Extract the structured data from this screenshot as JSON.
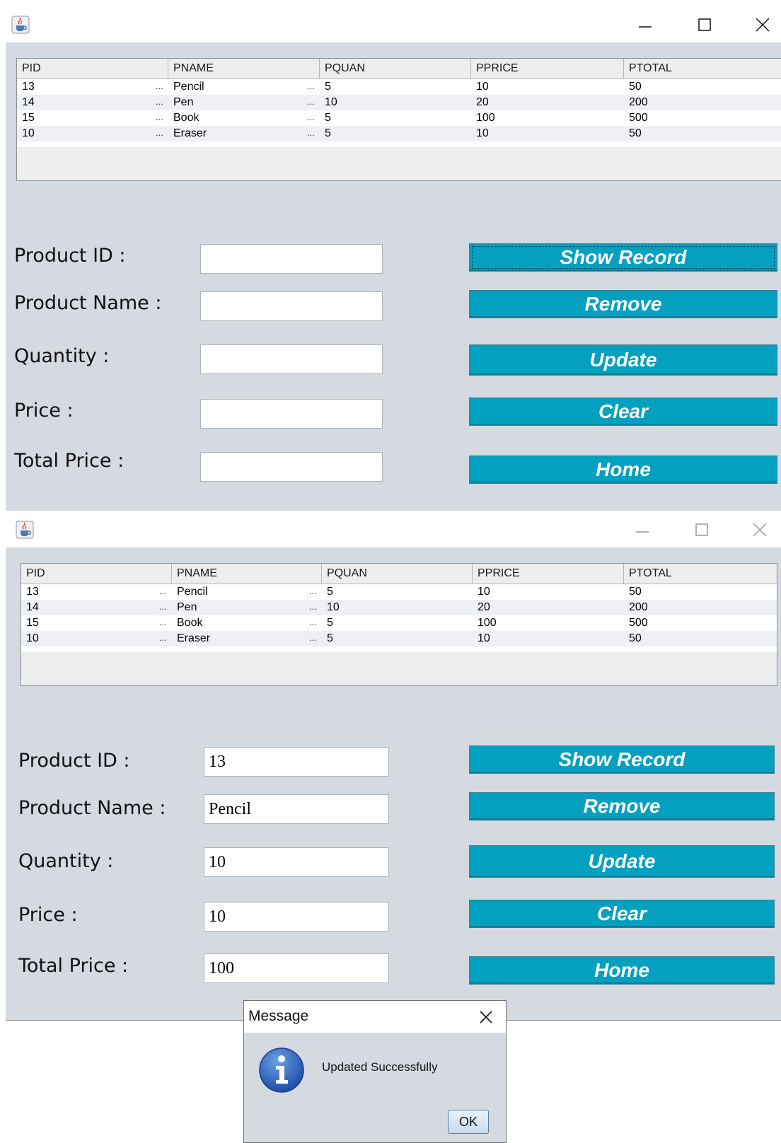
{
  "colors": {
    "button_bg": "#04a0c0",
    "window_bg": "#d5d9e0",
    "title_bg": "#ffffff"
  },
  "table": {
    "headers": [
      "PID",
      "PNAME",
      "PQUAN",
      "PPRICE",
      "PTOTAL"
    ],
    "rows": [
      [
        "13",
        "Pencil",
        "5",
        "10",
        "50"
      ],
      [
        "14",
        "Pen",
        "10",
        "20",
        "200"
      ],
      [
        "15",
        "Book",
        "5",
        "100",
        "500"
      ],
      [
        "10",
        "Eraser",
        "5",
        "10",
        "50"
      ]
    ],
    "ellipsis": "..."
  },
  "form": {
    "labels": {
      "product_id": "Product ID :",
      "product_name": "Product Name :",
      "quantity": "Quantity :",
      "price": "Price :",
      "total_price": "Total Price :"
    },
    "window1_values": {
      "product_id": "",
      "product_name": "",
      "quantity": "",
      "price": "",
      "total_price": ""
    },
    "window2_values": {
      "product_id": "13",
      "product_name": "Pencil",
      "quantity": "10",
      "price": "10",
      "total_price": "100"
    }
  },
  "buttons": {
    "show_record": "Show Record",
    "remove": "Remove",
    "update": "Update",
    "clear": "Clear",
    "home": "Home"
  },
  "dialog": {
    "title": "Message",
    "message": "Updated Successfully",
    "ok": "OK"
  },
  "icons": [
    "java-cup-icon",
    "minimize-icon",
    "maximize-icon",
    "close-icon",
    "info-icon"
  ]
}
